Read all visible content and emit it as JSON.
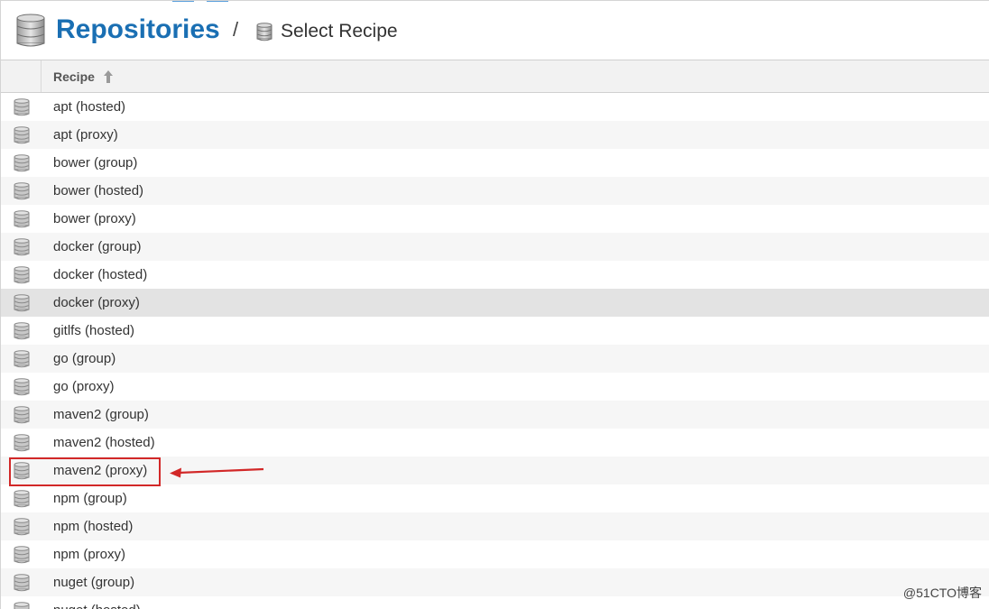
{
  "header": {
    "title": "Repositories",
    "separator": "/",
    "breadcrumb": "Select Recipe",
    "title_icon": "database-icon",
    "breadcrumb_icon": "database-icon"
  },
  "grid": {
    "column_header": "Recipe",
    "sort_icon": "sort-ascending-icon",
    "rows": [
      "apt (hosted)",
      "apt (proxy)",
      "bower (group)",
      "bower (hosted)",
      "bower (proxy)",
      "docker (group)",
      "docker (hosted)",
      "docker (proxy)",
      "gitlfs (hosted)",
      "go (group)",
      "go (proxy)",
      "maven2 (group)",
      "maven2 (hosted)",
      "maven2 (proxy)",
      "npm (group)",
      "npm (hosted)",
      "npm (proxy)",
      "nuget (group)",
      "nuget (hosted)"
    ],
    "hovered_row": "docker (proxy)",
    "annotated_row": "maven2 (proxy)"
  },
  "annotation": {
    "box_color": "#d22828",
    "arrow_color": "#d22828"
  },
  "watermark": "@51CTO博客",
  "colors": {
    "title": "#1a6fb3",
    "row_alt": "#f6f6f6",
    "row_hover": "#e3e3e3",
    "header_bg": "#f2f2f2"
  }
}
